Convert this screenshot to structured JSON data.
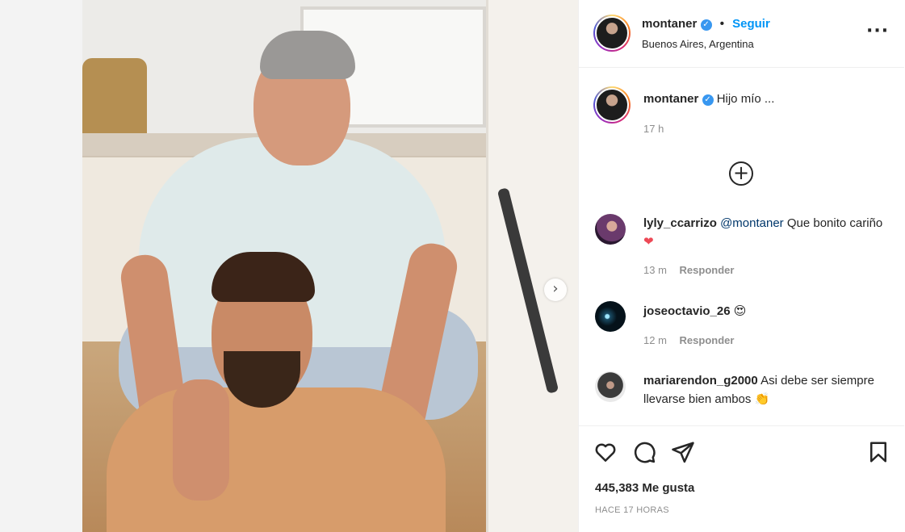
{
  "post": {
    "author": "montaner",
    "follow_label": "Seguir",
    "separator": "•",
    "location": "Buenos Aires, Argentina",
    "more_icon": "more-horizontal-icon",
    "caption": "Hijo mío ...",
    "caption_time": "17 h",
    "likes": "445,383 Me gusta",
    "posted": "HACE 17 HORAS",
    "carousel_next": "›"
  },
  "comments": [
    {
      "user": "lyly_ccarrizo",
      "mention": "@montaner",
      "text": " Que bonito cariño",
      "emoji": "❤",
      "time": "13 m",
      "reply": "Responder"
    },
    {
      "user": "joseoctavio_26",
      "mention": "",
      "text": "",
      "emoji": "😍",
      "time": "12 m",
      "reply": "Responder"
    },
    {
      "user": "mariarendon_g2000",
      "mention": "",
      "text": " Asi debe ser siempre llevarse bien ambos",
      "emoji": "👏",
      "time": "",
      "reply": ""
    }
  ],
  "colors": {
    "accent": "#0095f6",
    "verified": "#3897f0",
    "heart": "#ed4956",
    "muted": "#8e8e8e"
  },
  "icons": [
    "heart-icon",
    "comment-icon",
    "share-icon",
    "bookmark-icon",
    "add-circle-icon",
    "verified-icon"
  ]
}
